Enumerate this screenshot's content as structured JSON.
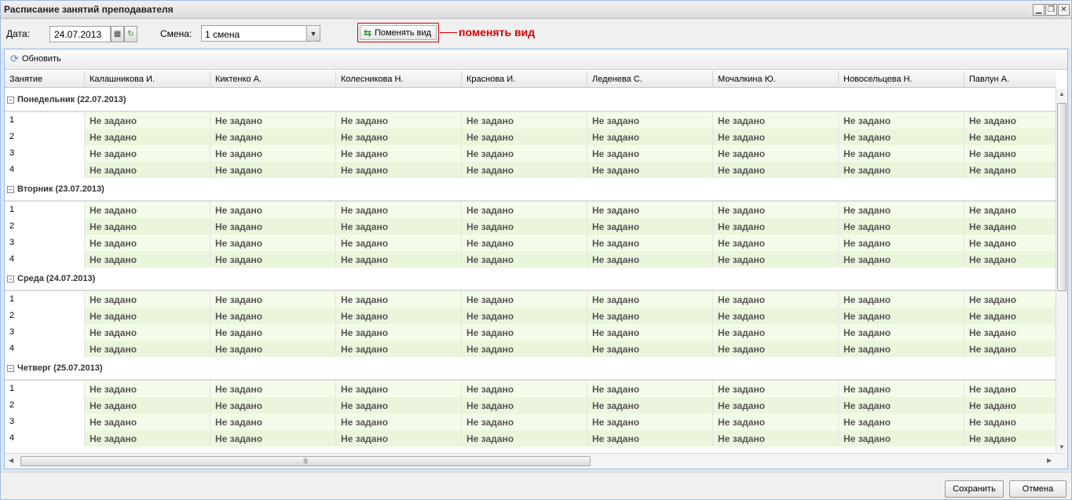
{
  "window": {
    "title": "Расписание занятий преподавателя"
  },
  "form": {
    "date_label": "Дата:",
    "date_value": "24.07.2013",
    "shift_label": "Смена:",
    "shift_value": "1 смена",
    "switch_view_button": "Поменять вид",
    "annotation": "поменять вид"
  },
  "toolbar": {
    "refresh_label": "Обновить"
  },
  "grid": {
    "first_column": "Занятие",
    "teachers": [
      "Калашникова И.",
      "Киктенко А.",
      "Колесникова Н.",
      "Краснова И.",
      "Леденева С.",
      "Мочалкина Ю.",
      "Новосельцева Н.",
      "Павлун А."
    ],
    "groups": [
      {
        "title": "Понедельник (22.07.2013)",
        "rows": [
          {
            "num": "1",
            "cells": [
              "Не задано",
              "Не задано",
              "Не задано",
              "Не задано",
              "Не задано",
              "Не задано",
              "Не задано",
              "Не задано"
            ]
          },
          {
            "num": "2",
            "cells": [
              "Не задано",
              "Не задано",
              "Не задано",
              "Не задано",
              "Не задано",
              "Не задано",
              "Не задано",
              "Не задано"
            ]
          },
          {
            "num": "3",
            "cells": [
              "Не задано",
              "Не задано",
              "Не задано",
              "Не задано",
              "Не задано",
              "Не задано",
              "Не задано",
              "Не задано"
            ]
          },
          {
            "num": "4",
            "cells": [
              "Не задано",
              "Не задано",
              "Не задано",
              "Не задано",
              "Не задано",
              "Не задано",
              "Не задано",
              "Не задано"
            ]
          }
        ]
      },
      {
        "title": "Вторник (23.07.2013)",
        "rows": [
          {
            "num": "1",
            "cells": [
              "Не задано",
              "Не задано",
              "Не задано",
              "Не задано",
              "Не задано",
              "Не задано",
              "Не задано",
              "Не задано"
            ]
          },
          {
            "num": "2",
            "cells": [
              "Не задано",
              "Не задано",
              "Не задано",
              "Не задано",
              "Не задано",
              "Не задано",
              "Не задано",
              "Не задано"
            ]
          },
          {
            "num": "3",
            "cells": [
              "Не задано",
              "Не задано",
              "Не задано",
              "Не задано",
              "Не задано",
              "Не задано",
              "Не задано",
              "Не задано"
            ]
          },
          {
            "num": "4",
            "cells": [
              "Не задано",
              "Не задано",
              "Не задано",
              "Не задано",
              "Не задано",
              "Не задано",
              "Не задано",
              "Не задано"
            ]
          }
        ]
      },
      {
        "title": "Среда (24.07.2013)",
        "rows": [
          {
            "num": "1",
            "cells": [
              "Не задано",
              "Не задано",
              "Не задано",
              "Не задано",
              "Не задано",
              "Не задано",
              "Не задано",
              "Не задано"
            ]
          },
          {
            "num": "2",
            "cells": [
              "Не задано",
              "Не задано",
              "Не задано",
              "Не задано",
              "Не задано",
              "Не задано",
              "Не задано",
              "Не задано"
            ]
          },
          {
            "num": "3",
            "cells": [
              "Не задано",
              "Не задано",
              "Не задано",
              "Не задано",
              "Не задано",
              "Не задано",
              "Не задано",
              "Не задано"
            ]
          },
          {
            "num": "4",
            "cells": [
              "Не задано",
              "Не задано",
              "Не задано",
              "Не задано",
              "Не задано",
              "Не задано",
              "Не задано",
              "Не задано"
            ]
          }
        ]
      },
      {
        "title": "Четверг (25.07.2013)",
        "rows": [
          {
            "num": "1",
            "cells": [
              "Не задано",
              "Не задано",
              "Не задано",
              "Не задано",
              "Не задано",
              "Не задано",
              "Не задано",
              "Не задано"
            ]
          },
          {
            "num": "2",
            "cells": [
              "Не задано",
              "Не задано",
              "Не задано",
              "Не задано",
              "Не задано",
              "Не задано",
              "Не задано",
              "Не задано"
            ]
          },
          {
            "num": "3",
            "cells": [
              "Не задано",
              "Не задано",
              "Не задано",
              "Не задано",
              "Не задано",
              "Не задано",
              "Не задано",
              "Не задано"
            ]
          },
          {
            "num": "4",
            "cells": [
              "Не задано",
              "Не задано",
              "Не задано",
              "Не задано",
              "Не задано",
              "Не задано",
              "Не задано",
              "Не задано"
            ]
          }
        ]
      }
    ]
  },
  "footer": {
    "save_label": "Сохранить",
    "cancel_label": "Отмена"
  },
  "icons": {
    "minimize": "minimize-icon",
    "restore": "restore-icon",
    "close": "close-icon",
    "calendar": "calendar-icon",
    "today": "today-icon",
    "dropdown": "chevron-down-icon",
    "switch": "switch-view-icon",
    "refresh": "refresh-icon",
    "collapse": "minus-icon"
  },
  "colors": {
    "annotation": "#dd0000",
    "row_light": "#f3fce8",
    "row_dark": "#eaf6dc"
  }
}
